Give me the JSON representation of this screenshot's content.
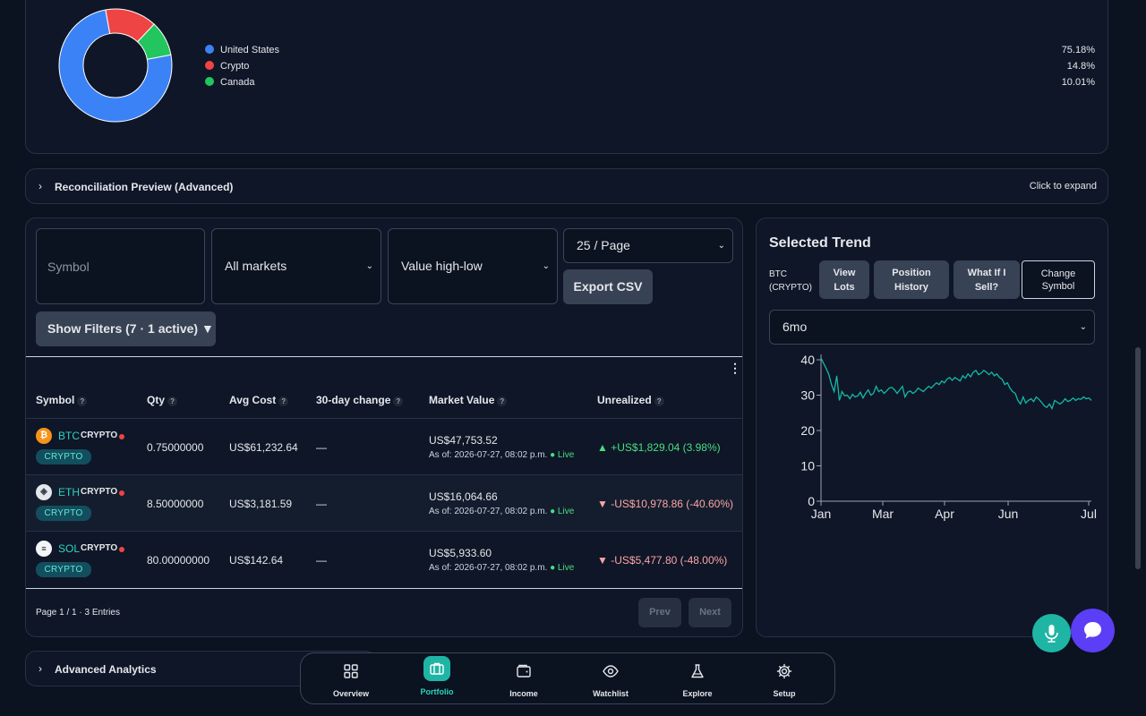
{
  "allocation": {
    "items": [
      {
        "label": "United States",
        "pct": "75.18%",
        "value": 75.18,
        "color": "#3b82f6"
      },
      {
        "label": "Crypto",
        "pct": "14.8%",
        "value": 14.8,
        "color": "#ef4444"
      },
      {
        "label": "Canada",
        "pct": "10.01%",
        "value": 10.01,
        "color": "#22c55e"
      }
    ]
  },
  "reconciliation": {
    "title": "Reconciliation Preview (Advanced)",
    "hint": "Click to expand"
  },
  "controls": {
    "symbol_placeholder": "Symbol",
    "market_select": "All markets",
    "sort_select": "Value high-low",
    "page_size_select": "25 / Page",
    "export_label": "Export CSV",
    "filters_label": "Show Filters (7 · 1 active) ▼"
  },
  "table": {
    "headers": [
      "Symbol",
      "Qty",
      "Avg Cost",
      "30-day change",
      "Market Value",
      "Unrealized"
    ],
    "help_icon": "?",
    "rows": [
      {
        "symbol": "BTC",
        "asset_class": "CRYPTO",
        "pill": "CRYPTO",
        "qty": "0.75000000",
        "avg_cost": "US$61,232.64",
        "change_30d": "—",
        "market_value": "US$47,753.52",
        "as_of": "As of: 2026-07-27, 08:02 p.m.",
        "live": "Live",
        "unrealized": "+US$1,829.04 (3.98%)",
        "direction": "up",
        "arrow": "▲",
        "icon": "₿"
      },
      {
        "symbol": "ETH",
        "asset_class": "CRYPTO",
        "pill": "CRYPTO",
        "qty": "8.50000000",
        "avg_cost": "US$3,181.59",
        "change_30d": "—",
        "market_value": "US$16,064.66",
        "as_of": "As of: 2026-07-27, 08:02 p.m.",
        "live": "Live",
        "unrealized": "-US$10,978.86 (-40.60%)",
        "direction": "down",
        "arrow": "▼",
        "icon": "◈"
      },
      {
        "symbol": "SOL",
        "asset_class": "CRYPTO",
        "pill": "CRYPTO",
        "qty": "80.00000000",
        "avg_cost": "US$142.64",
        "change_30d": "—",
        "market_value": "US$5,933.60",
        "as_of": "As of: 2026-07-27, 08:02 p.m.",
        "live": "Live",
        "unrealized": "-US$5,477.80 (-48.00%)",
        "direction": "down",
        "arrow": "▼",
        "icon": "≡"
      }
    ],
    "page_info": "Page 1 / 1 · 3 Entries",
    "prev_label": "Prev",
    "next_label": "Next"
  },
  "trend": {
    "title": "Selected Trend",
    "symbol_line1": "BTC",
    "symbol_line2": "(CRYPTO)",
    "btn_view_lots_1": "View",
    "btn_view_lots_2": "Lots",
    "btn_position_history_1": "Position",
    "btn_position_history_2": "History",
    "btn_what_if_1": "What If I",
    "btn_what_if_2": "Sell?",
    "btn_change_symbol_1": "Change",
    "btn_change_symbol_2": "Symbol",
    "range_select": "6mo"
  },
  "chart_data": {
    "type": "line",
    "xlabel": "",
    "ylabel": "",
    "x_ticks": [
      "Jan",
      "Mar",
      "Apr",
      "Jun",
      "Jul"
    ],
    "y_ticks": [
      0,
      10,
      20,
      30,
      40
    ],
    "ylim": [
      0,
      40
    ],
    "grid": false,
    "series": [
      {
        "color": "#14b8a6",
        "values": [
          40.5,
          39,
          37.5,
          35.8,
          33,
          31,
          35.5,
          28.5,
          31,
          29.8,
          30,
          29,
          30.2,
          29.5,
          29.8,
          30.8,
          29.2,
          30.5,
          31.5,
          30,
          30.5,
          32.5,
          31,
          31.5,
          30.5,
          31.2,
          32,
          32.2,
          31.5,
          30.5,
          31.5,
          32.5,
          29.5,
          30.8,
          31.2,
          30.5,
          31,
          32,
          31.5,
          31,
          31.8,
          32.5,
          32,
          32.8,
          33.5,
          33,
          34,
          33.5,
          34.5,
          35,
          34.2,
          35,
          34.5,
          34,
          35.5,
          34.8,
          36,
          35.2,
          36.5,
          37,
          35.8,
          36.2,
          37,
          36.5,
          35.8,
          36.5,
          35.5,
          36,
          35,
          34.5,
          33,
          33.5,
          32,
          31,
          30.5,
          28.5,
          27.5,
          29.5,
          27.8,
          28.5,
          29,
          28.2,
          29.5,
          28.8,
          28,
          27,
          26.5,
          27.5,
          26.2,
          28.5,
          28,
          27.5,
          28,
          29,
          28.2,
          28.5,
          29.2,
          28.5,
          29,
          28.8,
          29.5,
          29,
          29.2,
          28.5
        ]
      }
    ]
  },
  "advanced": {
    "title": "Advanced Analytics"
  },
  "nav": {
    "items": [
      {
        "label": "Overview",
        "icon": "grid-icon"
      },
      {
        "label": "Portfolio",
        "icon": "briefcase-icon",
        "active": true
      },
      {
        "label": "Income",
        "icon": "wallet-icon"
      },
      {
        "label": "Watchlist",
        "icon": "eye-icon"
      },
      {
        "label": "Explore",
        "icon": "flask-icon"
      },
      {
        "label": "Setup",
        "icon": "gear-icon"
      }
    ]
  }
}
